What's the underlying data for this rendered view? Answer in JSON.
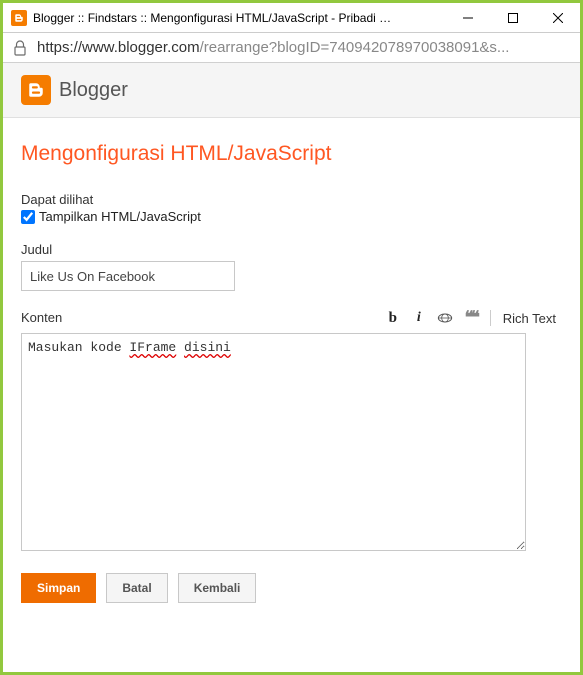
{
  "window": {
    "title": "Blogger :: Findstars :: Mengonfigurasi HTML/JavaScript - Pribadi - Microsoft..."
  },
  "address": {
    "scheme_host": "https://www.blogger.com",
    "path": "/rearrange?blogID=740942078970038091&s..."
  },
  "app": {
    "name": "Blogger"
  },
  "page": {
    "title": "Mengonfigurasi HTML/JavaScript",
    "visibility_label": "Dapat dilihat",
    "show_checkbox_label": "Tampilkan HTML/JavaScript",
    "show_checked": true,
    "judul_label": "Judul",
    "judul_value": "Like Us On Facebook",
    "konten_label": "Konten",
    "konten_prefix": "Masukan kode ",
    "konten_err1": "IFrame",
    "konten_mid": " ",
    "konten_err2": "disini"
  },
  "toolbar": {
    "bold": "b",
    "italic": "i",
    "quote": "❝❝",
    "richtext": "Rich Text"
  },
  "buttons": {
    "save": "Simpan",
    "cancel": "Batal",
    "back": "Kembali"
  }
}
